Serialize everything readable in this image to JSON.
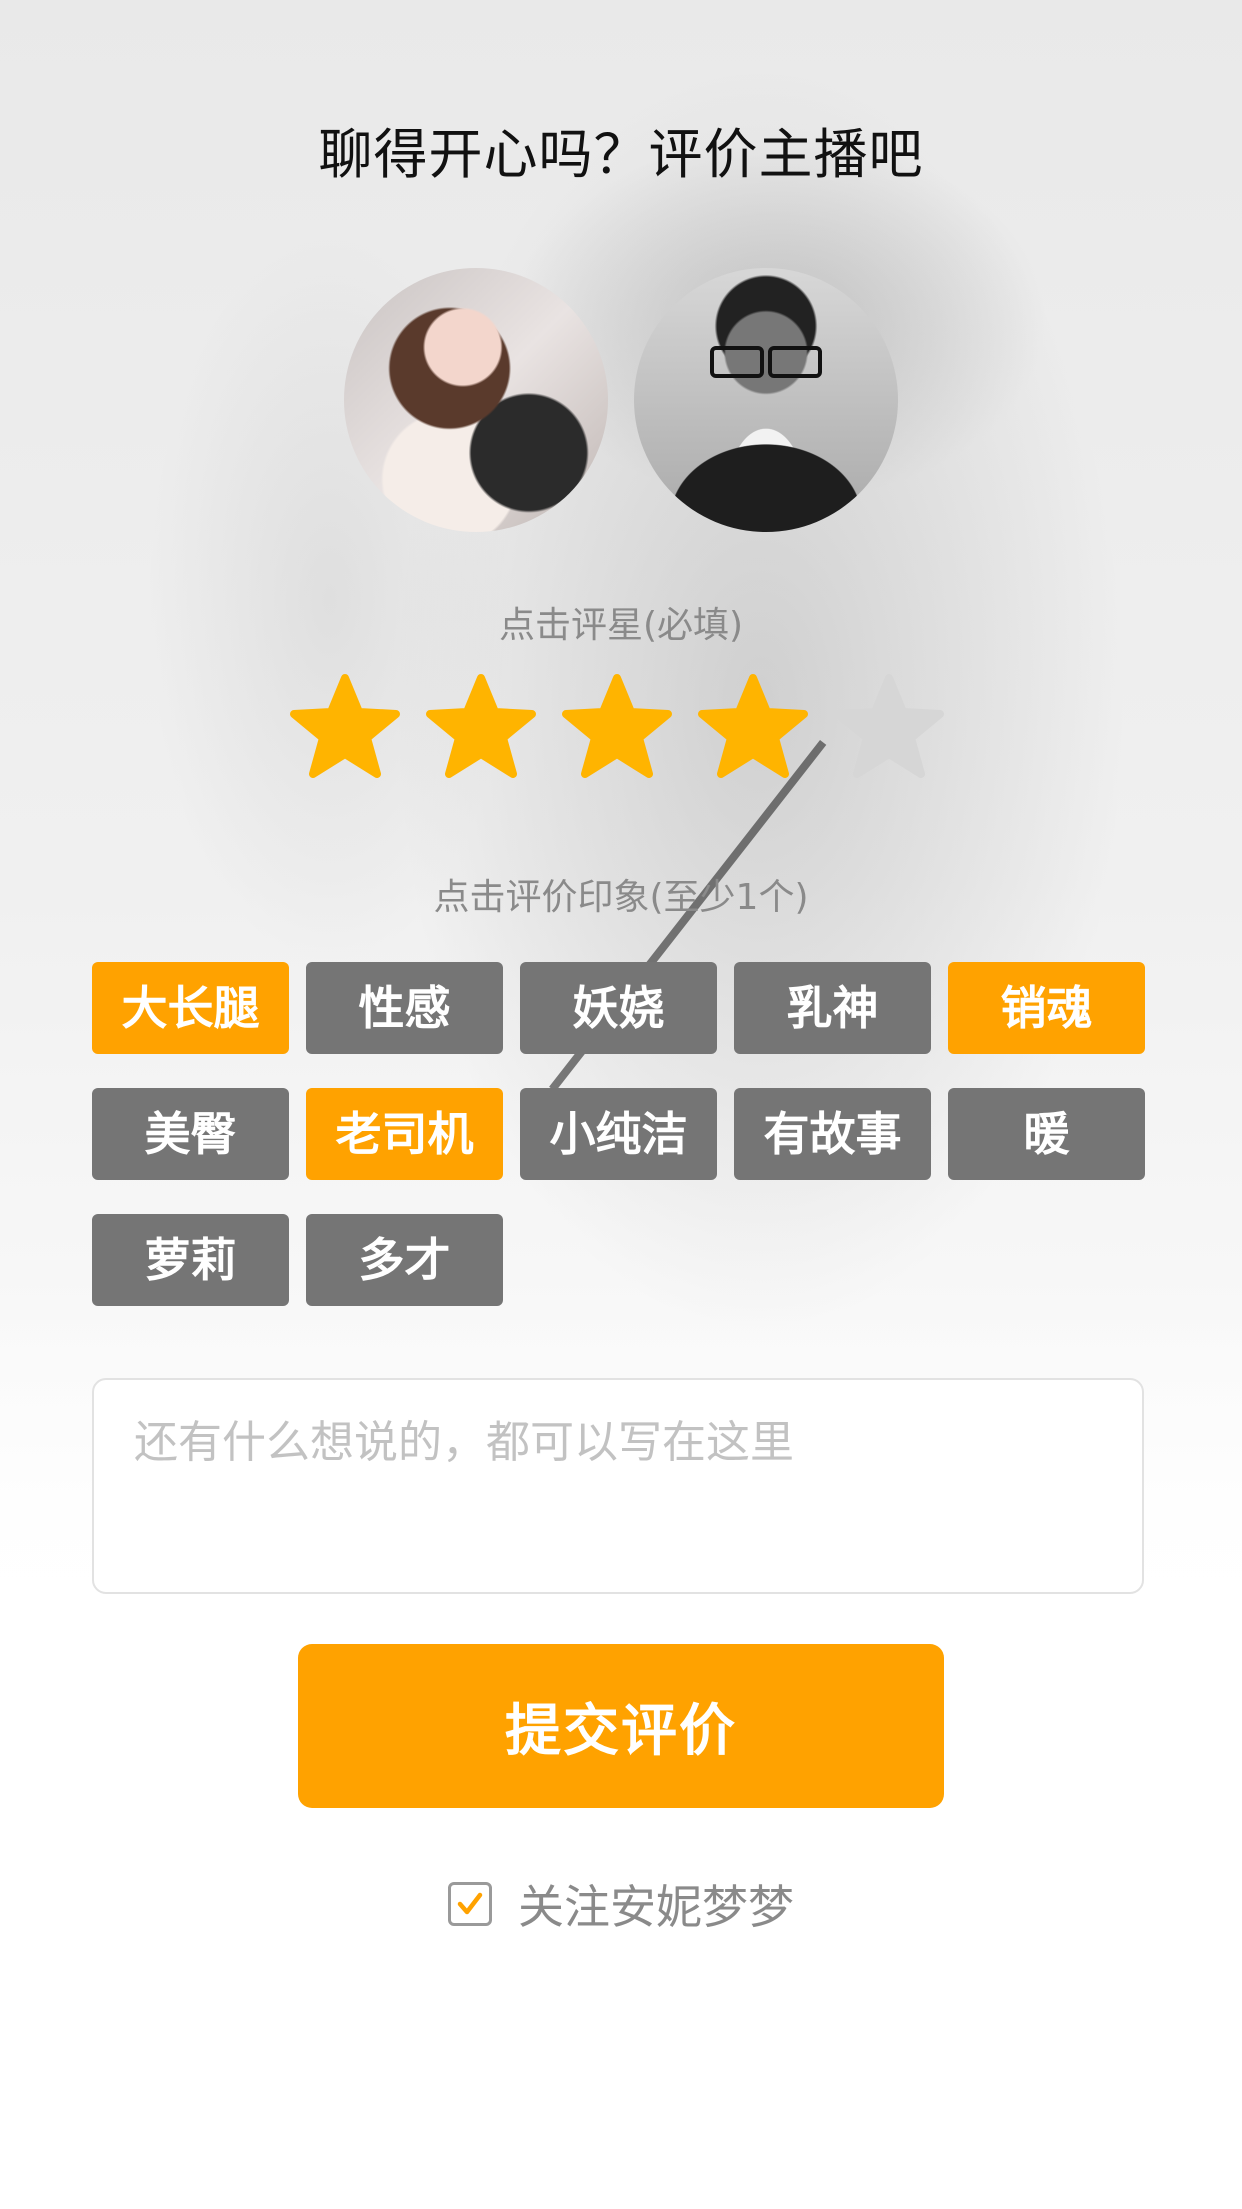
{
  "title": "聊得开心吗？评价主播吧",
  "rating": {
    "label": "点击评星(必填)",
    "value": 4,
    "max": 5,
    "filled_color": "#FFB400",
    "empty_color": "#D6D6D6"
  },
  "impressions": {
    "label": "点击评价印象(至少1个)",
    "tags": [
      {
        "label": "大长腿",
        "selected": true
      },
      {
        "label": "性感",
        "selected": false
      },
      {
        "label": "妖娆",
        "selected": false
      },
      {
        "label": "乳神",
        "selected": false
      },
      {
        "label": "销魂",
        "selected": true
      },
      {
        "label": "美臀",
        "selected": false
      },
      {
        "label": "老司机",
        "selected": true
      },
      {
        "label": "小纯洁",
        "selected": false
      },
      {
        "label": "有故事",
        "selected": false
      },
      {
        "label": "暖",
        "selected": false
      },
      {
        "label": "萝莉",
        "selected": false
      },
      {
        "label": "多才",
        "selected": false
      }
    ],
    "selected_color": "#FFA200",
    "unselected_color": "#757575"
  },
  "comment": {
    "placeholder": "还有什么想说的，都可以写在这里",
    "value": ""
  },
  "submit_label": "提交评价",
  "follow": {
    "label": "关注安妮梦梦",
    "checked": true,
    "check_color": "#FFA200"
  }
}
